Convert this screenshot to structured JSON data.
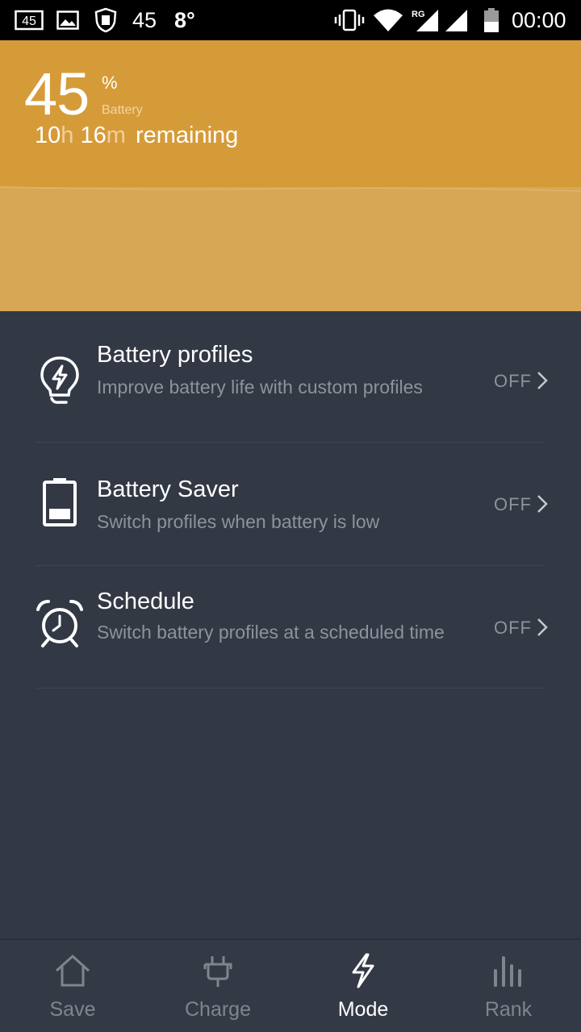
{
  "status_bar": {
    "notif_badge": "45",
    "battery_notif": "45",
    "temperature": "8°",
    "network_label": "RG",
    "time": "00:00"
  },
  "battery": {
    "percent": "45",
    "percent_sign": "%",
    "label": "Battery",
    "hours": "10",
    "hours_unit": "h",
    "minutes": "16",
    "minutes_unit": "m",
    "remaining_text": "remaining",
    "level": 45
  },
  "features": [
    {
      "title": "Battery profiles",
      "description": "Improve battery life with custom profiles",
      "status": "OFF",
      "icon": "lightbulb-bolt-icon"
    },
    {
      "title": "Battery Saver",
      "description": "Switch profiles when battery is low",
      "status": "OFF",
      "icon": "battery-low-icon"
    },
    {
      "title": "Schedule",
      "description": "Switch battery profiles at a scheduled time",
      "status": "OFF",
      "icon": "alarm-clock-icon"
    }
  ],
  "nav": {
    "tabs": [
      {
        "label": "Save",
        "icon": "home-icon"
      },
      {
        "label": "Charge",
        "icon": "plug-icon"
      },
      {
        "label": "Mode",
        "icon": "bolt-icon"
      },
      {
        "label": "Rank",
        "icon": "bars-icon"
      }
    ],
    "active": "Mode"
  },
  "colors": {
    "header_top": "#d69b39",
    "header_bottom": "#d8a756",
    "background": "#333845",
    "muted_text": "#8e929b"
  }
}
